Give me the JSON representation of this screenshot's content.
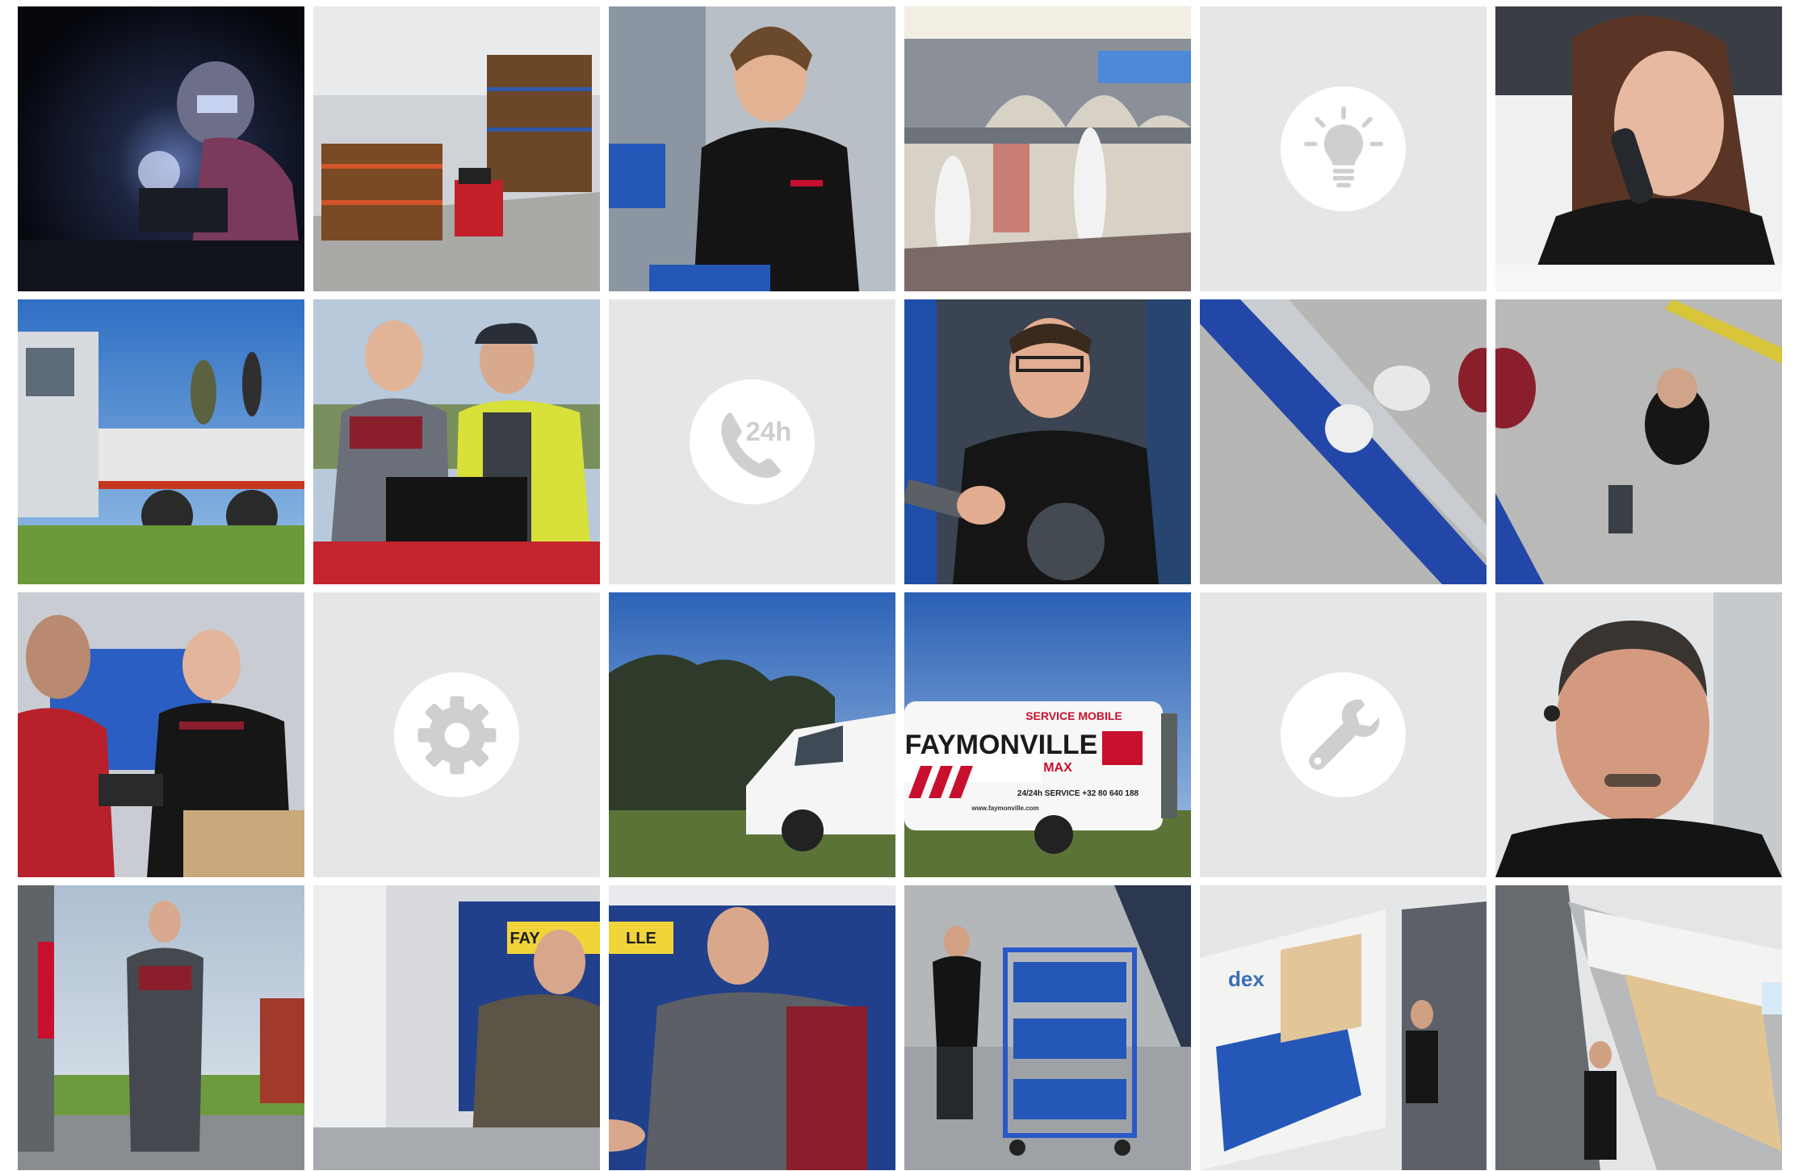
{
  "colors": {
    "tile_bg": "#e6e6e6",
    "icon_fg": "#cfcfcf",
    "brand_red": "#c8102e",
    "brand_blue": "#1f4ea8"
  },
  "icons": {
    "lightbulb": "lightbulb-icon",
    "phone_24h": "phone-24h-icon",
    "gear": "gear-icon",
    "wrench": "wrench-icon"
  },
  "texts": {
    "phone_24h_label": "24h",
    "van_service": "SERVICE MOBILE",
    "van_brand": "FAYMONVILLE",
    "van_sub": "MAX",
    "van_phone": "24/24h SERVICE  +32 80 640 188",
    "van_url": "www.faymonville.com",
    "banner_brand": "FAY",
    "banner_brand_end": "LLE",
    "shelf_label": "dex"
  }
}
